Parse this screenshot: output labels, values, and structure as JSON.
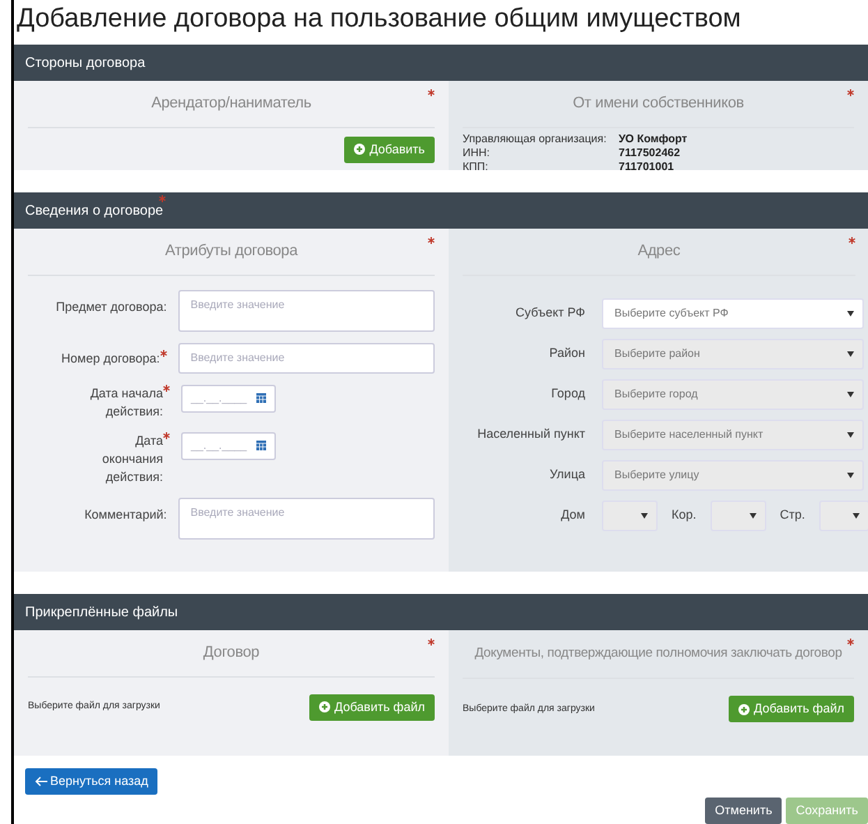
{
  "title": "Добавление договора на пользование общим имуществом",
  "parties": {
    "heading": "Стороны договора",
    "tenant": {
      "title": "Арендатор/наниматель",
      "required": true,
      "button": "Добавить"
    },
    "owner": {
      "title": "От имени собственников",
      "required": true,
      "rows": [
        {
          "label": "Управляющая организация:",
          "value": "УО Комфорт"
        },
        {
          "label": "ИНН:",
          "value": "7117502462"
        },
        {
          "label": "КПП:",
          "value": "711701001"
        }
      ]
    }
  },
  "details": {
    "heading": "Сведения о договоре",
    "required": true,
    "attributes": {
      "title": "Атрибуты договора",
      "required": true,
      "fields": [
        {
          "kind": "textarea",
          "label": "Предмет договора:",
          "required": false,
          "placeholder": "Введите значение"
        },
        {
          "kind": "text",
          "label": "Номер договора:",
          "required": true,
          "placeholder": "Введите значение"
        },
        {
          "kind": "date",
          "label": "Дата начала действия:",
          "required": true,
          "placeholder": "__.__.____"
        },
        {
          "kind": "date",
          "label": "Дата окончания действия:",
          "required": true,
          "placeholder": "__.__.____"
        },
        {
          "kind": "textarea",
          "label": "Комментарий:",
          "required": false,
          "placeholder": "Введите значение"
        }
      ]
    },
    "address": {
      "title": "Адрес",
      "required": true,
      "selects": [
        {
          "label": "Субъект РФ",
          "placeholder": "Выберите субъект РФ",
          "disabled": false
        },
        {
          "label": "Район",
          "placeholder": "Выберите район",
          "disabled": true
        },
        {
          "label": "Город",
          "placeholder": "Выберите город",
          "disabled": true
        },
        {
          "label": "Населенный пункт",
          "placeholder": "Выберите населенный пункт",
          "disabled": true
        },
        {
          "label": "Улица",
          "placeholder": "Выберите улицу",
          "disabled": true
        }
      ],
      "house": [
        {
          "label": "Дом",
          "disabled": true
        },
        {
          "label": "Кор.",
          "disabled": true
        },
        {
          "label": "Стр.",
          "disabled": true
        }
      ]
    }
  },
  "files": {
    "heading": "Прикреплённые файлы",
    "panels": [
      {
        "title": "Договор",
        "required": true,
        "hint": "Выберите файл для загрузки",
        "button": "Добавить файл"
      },
      {
        "title": "Документы, подтверждающие полномочия заключать договор",
        "required": true,
        "hint": "Выберите файл для загрузки",
        "button": "Добавить файл"
      }
    ]
  },
  "back_button": "Вернуться назад",
  "footer_buttons": [
    {
      "kind": "cancel",
      "label": "Отменить",
      "disabled": false
    },
    {
      "kind": "save",
      "label": "Сохранить",
      "disabled": true
    }
  ]
}
